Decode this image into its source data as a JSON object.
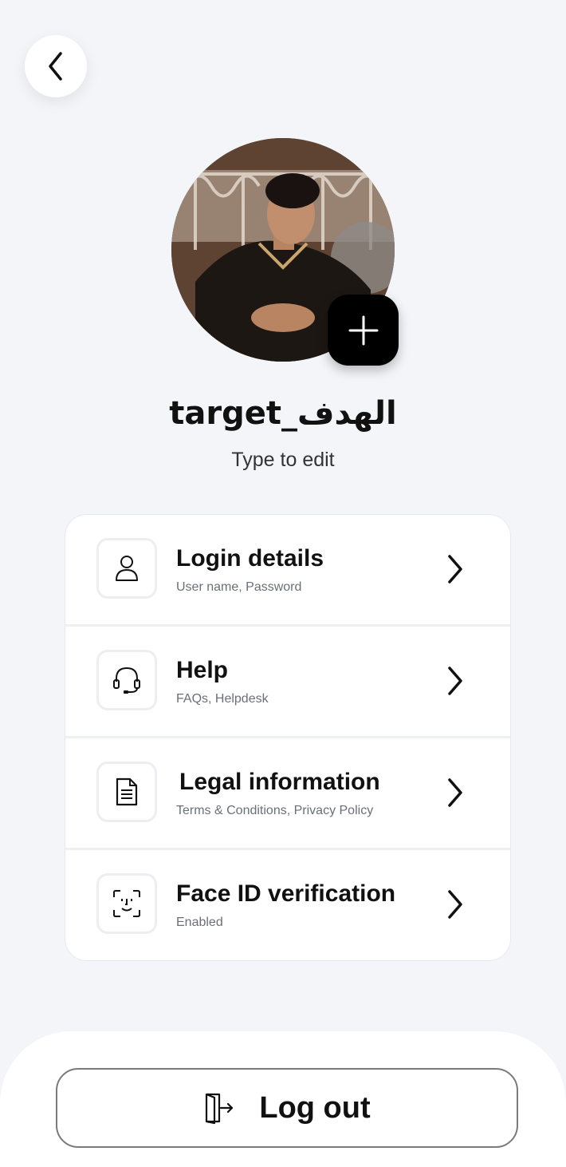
{
  "header": {
    "back_icon": "chevron-left-icon"
  },
  "profile": {
    "username": "target_الهدف",
    "edit_hint": "Type to edit",
    "add_photo_icon": "plus-icon"
  },
  "menu": {
    "items": [
      {
        "title": "Login details",
        "subtitle": "User name, Password",
        "icon": "user-icon"
      },
      {
        "title": "Help",
        "subtitle": "FAQs, Helpdesk",
        "icon": "headset-icon"
      },
      {
        "title": "Legal information",
        "subtitle": "Terms & Conditions, Privacy Policy",
        "icon": "document-icon"
      },
      {
        "title": "Face ID verification",
        "subtitle": "Enabled",
        "icon": "face-id-icon"
      }
    ]
  },
  "footer": {
    "logout_label": "Log out",
    "logout_icon": "logout-door-icon"
  },
  "colors": {
    "background": "#f3f5f9",
    "card": "#ffffff",
    "primary_text": "#111111",
    "secondary_text": "#6b6f78",
    "accent_button": "#000000"
  }
}
